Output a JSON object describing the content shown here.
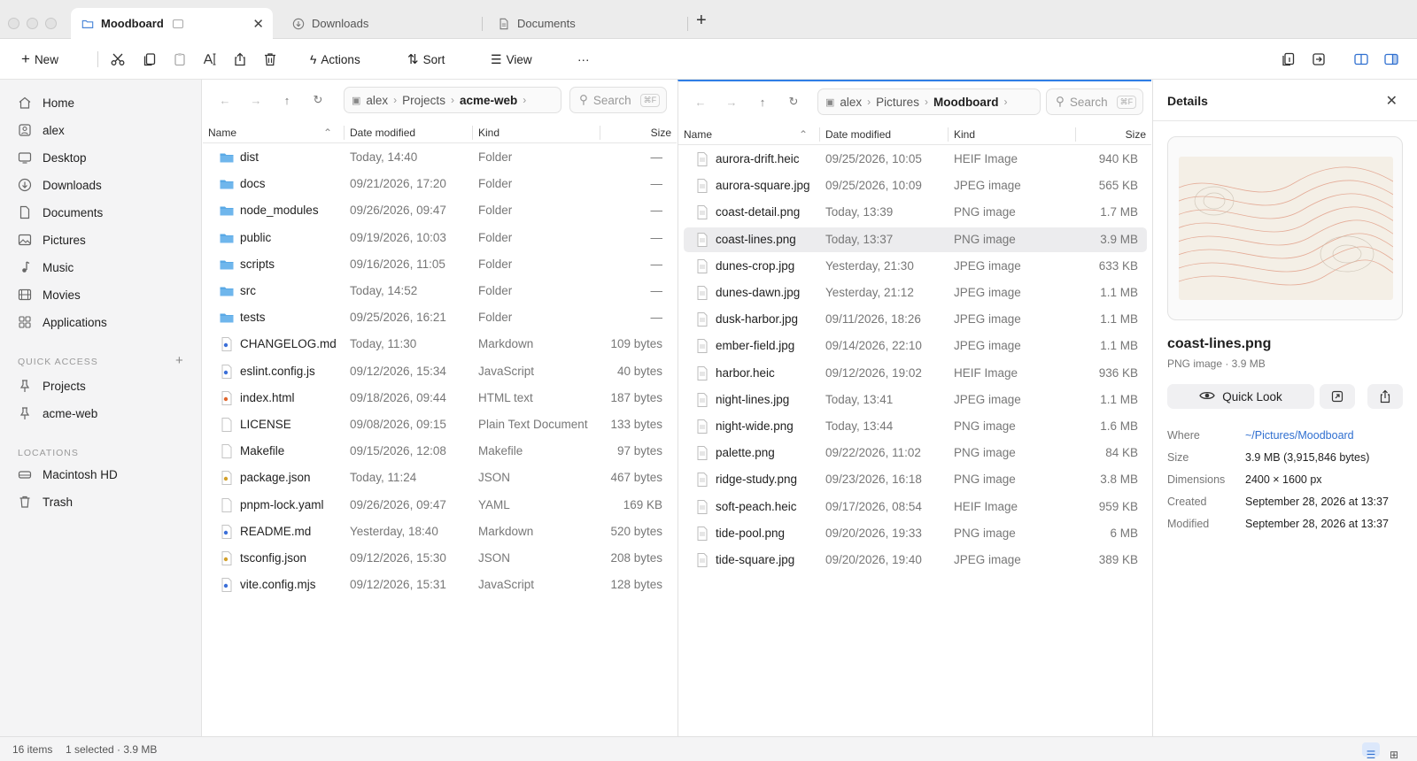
{
  "tabs": [
    {
      "label": "Moodboard",
      "active": true
    },
    {
      "label": "Downloads",
      "active": false
    },
    {
      "label": "Documents",
      "active": false
    }
  ],
  "toolbar": {
    "new_label": "New",
    "actions_label": "Actions",
    "sort_label": "Sort",
    "view_label": "View",
    "more_label": "···"
  },
  "sidebar": {
    "items": [
      {
        "label": "Home",
        "icon": "home-icon"
      },
      {
        "label": "alex",
        "icon": "user-icon"
      },
      {
        "label": "Desktop",
        "icon": "desktop-icon"
      },
      {
        "label": "Downloads",
        "icon": "download-icon"
      },
      {
        "label": "Documents",
        "icon": "document-icon"
      },
      {
        "label": "Pictures",
        "icon": "picture-icon"
      },
      {
        "label": "Music",
        "icon": "music-icon"
      },
      {
        "label": "Movies",
        "icon": "movie-icon"
      },
      {
        "label": "Applications",
        "icon": "apps-icon"
      }
    ],
    "quick_access_label": "QUICK ACCESS",
    "quick_access": [
      {
        "label": "Projects",
        "icon": "pin-icon"
      },
      {
        "label": "acme-web",
        "icon": "pin-icon"
      }
    ],
    "locations_label": "LOCATIONS",
    "locations": [
      {
        "label": "Macintosh HD",
        "icon": "drive-icon"
      },
      {
        "label": "Trash",
        "icon": "trash-icon"
      }
    ]
  },
  "left_pane": {
    "breadcrumb": [
      "alex",
      "Projects",
      "acme-web"
    ],
    "search_placeholder": "Search",
    "search_shortcut": "⌘F",
    "columns": {
      "name": "Name",
      "date": "Date modified",
      "kind": "Kind",
      "size": "Size"
    },
    "rows": [
      {
        "name": "dist",
        "date": "Today, 14:40",
        "kind": "Folder",
        "size": "—",
        "type": "folder"
      },
      {
        "name": "docs",
        "date": "09/21/2026, 17:20",
        "kind": "Folder",
        "size": "—",
        "type": "folder"
      },
      {
        "name": "node_modules",
        "date": "09/26/2026, 09:47",
        "kind": "Folder",
        "size": "—",
        "type": "folder"
      },
      {
        "name": "public",
        "date": "09/19/2026, 10:03",
        "kind": "Folder",
        "size": "—",
        "type": "folder"
      },
      {
        "name": "scripts",
        "date": "09/16/2026, 11:05",
        "kind": "Folder",
        "size": "—",
        "type": "folder"
      },
      {
        "name": "src",
        "date": "Today, 14:52",
        "kind": "Folder",
        "size": "—",
        "type": "folder"
      },
      {
        "name": "tests",
        "date": "09/25/2026, 16:21",
        "kind": "Folder",
        "size": "—",
        "type": "folder"
      },
      {
        "name": "CHANGELOG.md",
        "date": "Today, 11:30",
        "kind": "Markdown",
        "size": "109 bytes",
        "type": "md"
      },
      {
        "name": "eslint.config.js",
        "date": "09/12/2026, 15:34",
        "kind": "JavaScript",
        "size": "40 bytes",
        "type": "js"
      },
      {
        "name": "index.html",
        "date": "09/18/2026, 09:44",
        "kind": "HTML text",
        "size": "187 bytes",
        "type": "html"
      },
      {
        "name": "LICENSE",
        "date": "09/08/2026, 09:15",
        "kind": "Plain Text Document",
        "size": "133 bytes",
        "type": "text"
      },
      {
        "name": "Makefile",
        "date": "09/15/2026, 12:08",
        "kind": "Makefile",
        "size": "97 bytes",
        "type": "text"
      },
      {
        "name": "package.json",
        "date": "Today, 11:24",
        "kind": "JSON",
        "size": "467 bytes",
        "type": "json"
      },
      {
        "name": "pnpm-lock.yaml",
        "date": "09/26/2026, 09:47",
        "kind": "YAML",
        "size": "169 KB",
        "type": "text"
      },
      {
        "name": "README.md",
        "date": "Yesterday, 18:40",
        "kind": "Markdown",
        "size": "520 bytes",
        "type": "md"
      },
      {
        "name": "tsconfig.json",
        "date": "09/12/2026, 15:30",
        "kind": "JSON",
        "size": "208 bytes",
        "type": "json"
      },
      {
        "name": "vite.config.mjs",
        "date": "09/12/2026, 15:31",
        "kind": "JavaScript",
        "size": "128 bytes",
        "type": "js"
      }
    ]
  },
  "right_pane": {
    "breadcrumb": [
      "alex",
      "Pictures",
      "Moodboard"
    ],
    "search_placeholder": "Search",
    "search_shortcut": "⌘F",
    "columns": {
      "name": "Name",
      "date": "Date modified",
      "kind": "Kind",
      "size": "Size"
    },
    "rows": [
      {
        "name": "aurora-drift.heic",
        "date": "09/25/2026, 10:05",
        "kind": "HEIF Image",
        "size": "940 KB"
      },
      {
        "name": "aurora-square.jpg",
        "date": "09/25/2026, 10:09",
        "kind": "JPEG image",
        "size": "565 KB"
      },
      {
        "name": "coast-detail.png",
        "date": "Today, 13:39",
        "kind": "PNG image",
        "size": "1.7 MB"
      },
      {
        "name": "coast-lines.png",
        "date": "Today, 13:37",
        "kind": "PNG image",
        "size": "3.9 MB",
        "selected": true
      },
      {
        "name": "dunes-crop.jpg",
        "date": "Yesterday, 21:30",
        "kind": "JPEG image",
        "size": "633 KB"
      },
      {
        "name": "dunes-dawn.jpg",
        "date": "Yesterday, 21:12",
        "kind": "JPEG image",
        "size": "1.1 MB"
      },
      {
        "name": "dusk-harbor.jpg",
        "date": "09/11/2026, 18:26",
        "kind": "JPEG image",
        "size": "1.1 MB"
      },
      {
        "name": "ember-field.jpg",
        "date": "09/14/2026, 22:10",
        "kind": "JPEG image",
        "size": "1.1 MB"
      },
      {
        "name": "harbor.heic",
        "date": "09/12/2026, 19:02",
        "kind": "HEIF Image",
        "size": "936 KB"
      },
      {
        "name": "night-lines.jpg",
        "date": "Today, 13:41",
        "kind": "JPEG image",
        "size": "1.1 MB"
      },
      {
        "name": "night-wide.png",
        "date": "Today, 13:44",
        "kind": "PNG image",
        "size": "1.6 MB"
      },
      {
        "name": "palette.png",
        "date": "09/22/2026, 11:02",
        "kind": "PNG image",
        "size": "84 KB"
      },
      {
        "name": "ridge-study.png",
        "date": "09/23/2026, 16:18",
        "kind": "PNG image",
        "size": "3.8 MB"
      },
      {
        "name": "soft-peach.heic",
        "date": "09/17/2026, 08:54",
        "kind": "HEIF Image",
        "size": "959 KB"
      },
      {
        "name": "tide-pool.png",
        "date": "09/20/2026, 19:33",
        "kind": "PNG image",
        "size": "6 MB"
      },
      {
        "name": "tide-square.jpg",
        "date": "09/20/2026, 19:40",
        "kind": "JPEG image",
        "size": "389 KB"
      }
    ]
  },
  "details": {
    "title": "Details",
    "file_name": "coast-lines.png",
    "subtitle": "PNG image · 3.9 MB",
    "quick_look_label": "Quick Look",
    "meta": [
      {
        "label": "Where",
        "value": "~/Pictures/Moodboard",
        "link": true
      },
      {
        "label": "Size",
        "value": "3.9 MB (3,915,846 bytes)"
      },
      {
        "label": "Dimensions",
        "value": "2400 × 1600 px"
      },
      {
        "label": "Created",
        "value": "September 28, 2026 at 13:37"
      },
      {
        "label": "Modified",
        "value": "September 28, 2026 at 13:37"
      }
    ]
  },
  "status": {
    "items_count": "16 items",
    "selection": "1 selected · 3.9 MB"
  },
  "colors": {
    "accent": "#2f7ee6",
    "folder": "#5aa9e6",
    "selection": "#ececee"
  }
}
